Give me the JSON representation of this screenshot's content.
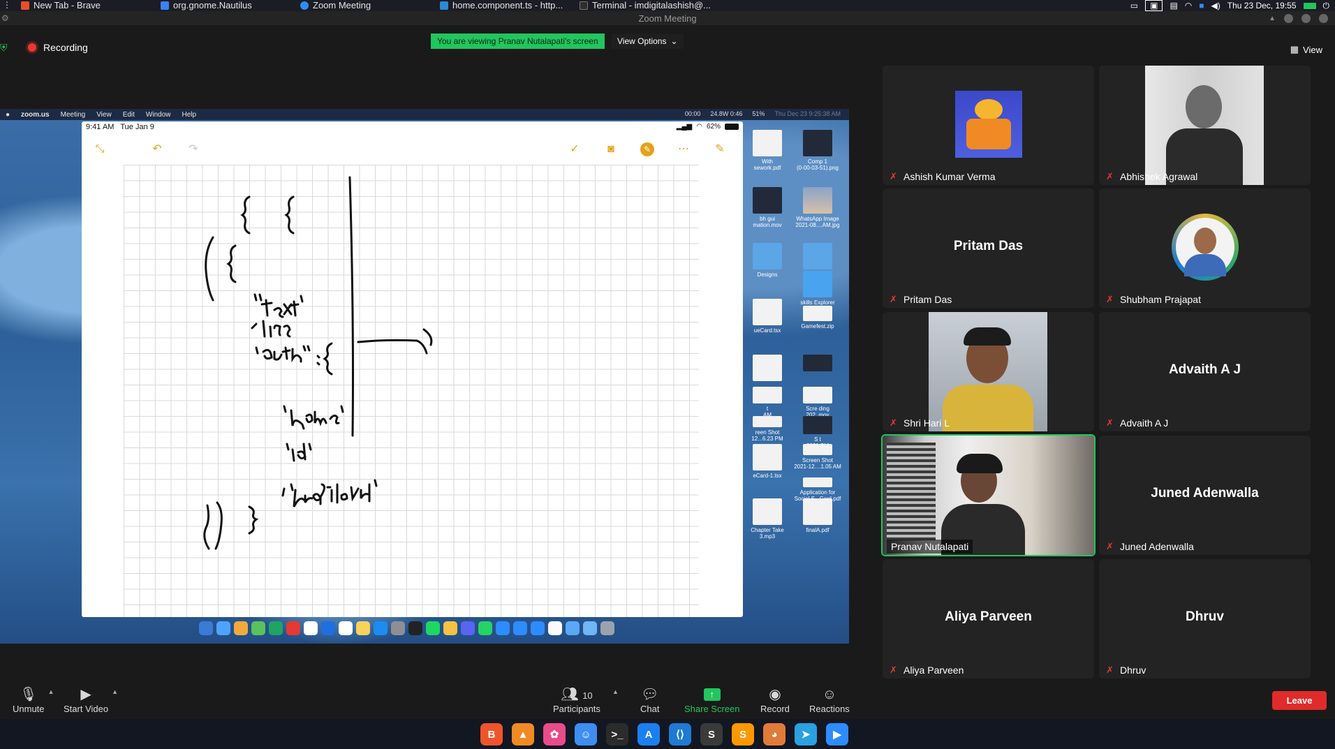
{
  "system_bar": {
    "tabs": [
      {
        "label": "New Tab - Brave",
        "icon": "brave-icon",
        "color": "#e94e2a"
      },
      {
        "label": "org.gnome.Nautilus",
        "icon": "files-icon",
        "color": "#3b82f6"
      },
      {
        "label": "Zoom Meeting",
        "icon": "zoom-icon",
        "color": "#2d8cff"
      },
      {
        "label": "home.component.ts - http...",
        "icon": "vscode-icon",
        "color": "#2b8ad8"
      },
      {
        "label": "Terminal - imdigitalashish@...",
        "icon": "terminal-icon",
        "color": "#2e2e2e"
      }
    ],
    "clock": "Thu 23 Dec, 19:55"
  },
  "window": {
    "title": "Zoom Meeting"
  },
  "zoom_top": {
    "recording_label": "Recording",
    "viewing_banner": "You are viewing Pranav Nutalapati's screen",
    "view_options_label": "View Options",
    "view_label": "View"
  },
  "shared_screen": {
    "mac_menu": [
      "zoom.us",
      "Meeting",
      "View",
      "Edit",
      "Window",
      "Help"
    ],
    "mac_status": [
      "00:00",
      "24.8W 0:46",
      "51%",
      "Thu Dec 23  9:25:38 AM"
    ],
    "ipad": {
      "time": "9:41 AM",
      "date": "Tue Jan 9",
      "battery": "62%"
    },
    "desktop_icons": [
      {
        "label": "With\nsework.pdf",
        "style": "doc"
      },
      {
        "label": "Comp 1\n(0-00-03-51).png",
        "style": "dark"
      },
      {
        "label": "bh gui\nmation.mov",
        "style": "dark"
      },
      {
        "label": "WhatsApp Image\n2021-08....AM.jpg",
        "style": "photo"
      },
      {
        "label": "Designs",
        "style": "blue"
      },
      {
        "label": "",
        "style": "blue"
      },
      {
        "label": "ueCard.tsx",
        "style": "doc"
      },
      {
        "label": "skills Explorer\ndemo.mai",
        "style": "doc"
      },
      {
        "label": "Gamefest.zip",
        "style": "doc"
      },
      {
        "label": "",
        "style": "doc"
      },
      {
        "label": "",
        "style": "dark"
      },
      {
        "label": "t\nAM",
        "style": "doc"
      },
      {
        "label": "Scre          ding\n202           .mov",
        "style": "doc"
      },
      {
        "label": "reen Shot\n12...6.23 PM",
        "style": "doc"
      },
      {
        "label": "S           t\n2021        PM",
        "style": "dark"
      },
      {
        "label": "eCard-1.tsx",
        "style": "doc"
      },
      {
        "label": "Screen Shot\n2021-12....1.05 AM",
        "style": "doc"
      },
      {
        "label": "Application for\nSocial S...Card.pdf",
        "style": "doc"
      },
      {
        "label": "Chapter Take\n3.mp3",
        "style": "doc"
      },
      {
        "label": "finalA.pdf",
        "style": "doc"
      }
    ],
    "dock_colors": [
      "#3a7bd5",
      "#4da3ff",
      "#f2a93b",
      "#5bc15b",
      "#1fa463",
      "#e53935",
      "#ffffff",
      "#1f6fe0",
      "#ffffff",
      "#f7d35c",
      "#1c8cf0",
      "#8e8e93",
      "#222222",
      "#1ed760",
      "#f5c242",
      "#5865f2",
      "#25d366",
      "#2d8cff",
      "#2d8cff",
      "#2d8cff",
      "#fafafa",
      "#5aa9f5",
      "#6fb6f5",
      "#9aa3ad"
    ]
  },
  "participants": [
    {
      "name": "Ashish Kumar Verma",
      "display": "image",
      "muted": true
    },
    {
      "name": "Abhishek Agrawal",
      "display": "image",
      "muted": true
    },
    {
      "name": "Pritam Das",
      "display": "name",
      "muted": true
    },
    {
      "name": "Shubham Prajapat",
      "display": "image",
      "muted": true
    },
    {
      "name": "Shri Hari L",
      "display": "image",
      "muted": true
    },
    {
      "name": "Advaith A J",
      "display": "name",
      "muted": true
    },
    {
      "name": "Pranav Nutalapati",
      "display": "video",
      "muted": false,
      "active_speaker": true
    },
    {
      "name": "Juned Adenwalla",
      "display": "name",
      "muted": true
    },
    {
      "name": "Aliya Parveen",
      "display": "name",
      "muted": true
    },
    {
      "name": "Dhruv",
      "display": "name",
      "muted": true
    }
  ],
  "bottom_bar": {
    "unmute": "Unmute",
    "start_video": "Start Video",
    "participants": "Participants",
    "participants_count": "10",
    "chat": "Chat",
    "share_screen": "Share Screen",
    "record": "Record",
    "reactions": "Reactions",
    "leave": "Leave"
  },
  "linux_dock": [
    {
      "icon": "brave-icon",
      "color": "#f0542b",
      "glyph": "B"
    },
    {
      "icon": "vlc-icon",
      "color": "#f08a24",
      "glyph": "▲"
    },
    {
      "icon": "photos-icon",
      "color": "#e94b8c",
      "glyph": "✿"
    },
    {
      "icon": "finder-icon",
      "color": "#3d8ef0",
      "glyph": "☺"
    },
    {
      "icon": "terminal-icon",
      "color": "#2b2b2b",
      "glyph": ">_"
    },
    {
      "icon": "appstore-icon",
      "color": "#1c7ff0",
      "glyph": "A"
    },
    {
      "icon": "vscode-icon",
      "color": "#1f7ad3",
      "glyph": "⟨⟩"
    },
    {
      "icon": "inkscape-icon",
      "color": "#3a3a3a",
      "glyph": "S"
    },
    {
      "icon": "sublime-icon",
      "color": "#ff9800",
      "glyph": "S"
    },
    {
      "icon": "app-icon",
      "color": "#e07b39",
      "glyph": "◕"
    },
    {
      "icon": "telegram-icon",
      "color": "#2aa1e1",
      "glyph": "➤"
    },
    {
      "icon": "zoom-icon",
      "color": "#2d8cff",
      "glyph": "▶"
    }
  ]
}
